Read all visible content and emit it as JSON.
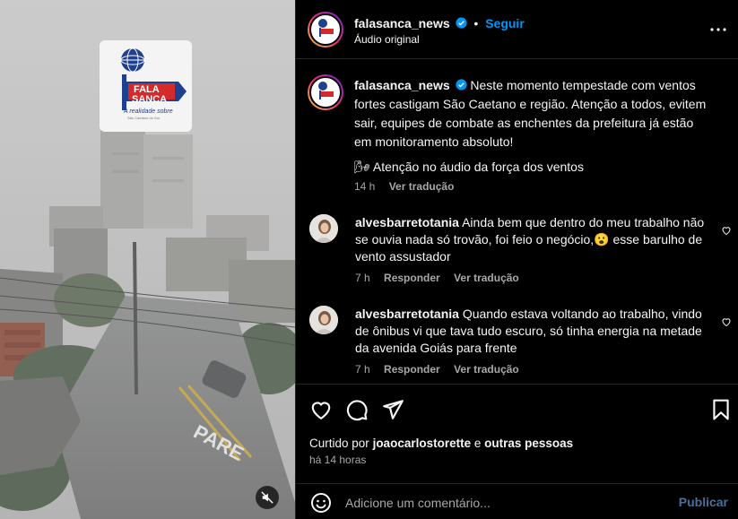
{
  "media": {
    "logo_line1": "FALA",
    "logo_line2": "SANCA",
    "logo_tagline": "A realidade sobre",
    "logo_small": "São Caetano do Sul",
    "street_text": "PARE"
  },
  "header": {
    "username": "falasanca_news",
    "separator": "•",
    "follow_label": "Seguir",
    "subtitle": "Áudio original"
  },
  "caption": {
    "username": "falasanca_news",
    "text": "Neste momento tempestade com ventos fortes castigam São Caetano e região. Atenção a todos, evitem sair, equipes de combate as enchentes da prefeitura já estão em monitoramento absoluto!",
    "extra_emoji": "🌬",
    "extra_text": "Atenção no áudio da força dos ventos",
    "time": "14 h",
    "translate_label": "Ver tradução"
  },
  "comments": [
    {
      "username": "alvesbarretotania",
      "text": "Ainda bem que dentro do meu trabalho não se ouvia nada só trovão, foi feio o negócio,😮 esse barulho de vento assustador",
      "time": "7 h",
      "reply_label": "Responder",
      "translate_label": "Ver tradução"
    },
    {
      "username": "alvesbarretotania",
      "text": "Quando estava voltando ao trabalho, vindo de ônibus vi que tava tudo escuro, só tinha energia na metade da avenida Goiás para frente",
      "time": "7 h",
      "reply_label": "Responder",
      "translate_label": "Ver tradução"
    }
  ],
  "likes": {
    "prefix": "Curtido por",
    "user": "joaocarlostorette",
    "conjunction": "e",
    "others": "outras pessoas"
  },
  "time_ago": "há 14 horas",
  "composer": {
    "placeholder": "Adicione um comentário...",
    "publish_label": "Publicar"
  },
  "icons": {
    "like": "heart-icon",
    "comment": "comment-icon",
    "share": "share-icon",
    "save": "bookmark-icon",
    "more": "more-options-icon",
    "emoji": "emoji-icon",
    "mute": "muted-speaker-icon",
    "verified": "verified-badge-icon"
  },
  "colors": {
    "accent": "#0095f6",
    "background": "#000000",
    "muted_text": "#a8a8a8",
    "publish_disabled": "#4a6f96",
    "logo_red": "#d42a2a",
    "logo_blue": "#1f3f8f"
  }
}
